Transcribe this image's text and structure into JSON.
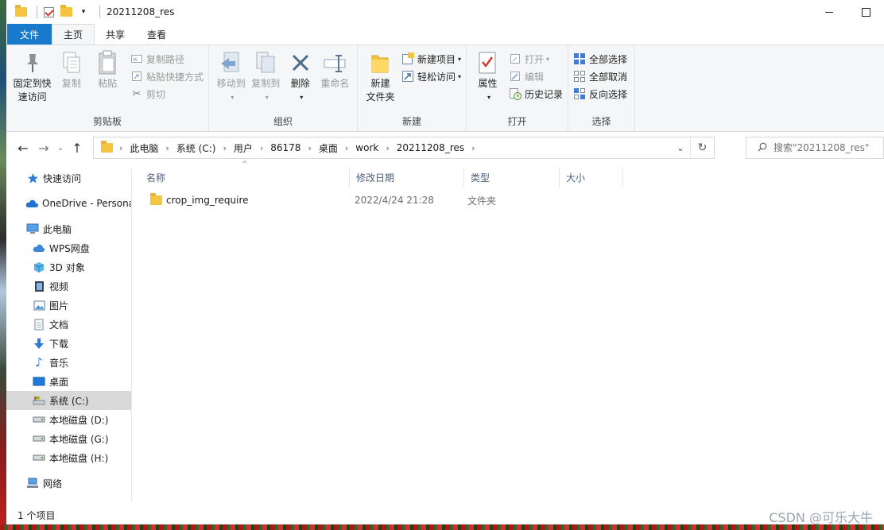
{
  "window": {
    "title": "20211208_res"
  },
  "tabs": [
    "文件",
    "主页",
    "共享",
    "查看"
  ],
  "ribbon": {
    "clipboard": {
      "label": "剪贴板",
      "pin": "固定到快\n速访问",
      "copy": "复制",
      "paste": "粘贴",
      "copy_path": "复制路径",
      "paste_shortcut": "粘贴快捷方式",
      "cut": "剪切"
    },
    "organize": {
      "label": "组织",
      "move_to": "移动到",
      "copy_to": "复制到",
      "delete": "删除",
      "rename": "重命名"
    },
    "new": {
      "label": "新建",
      "new_folder": "新建\n文件夹",
      "new_item": "新建项目",
      "easy_access": "轻松访问"
    },
    "open": {
      "label": "打开",
      "properties": "属性",
      "open": "打开",
      "edit": "编辑",
      "history": "历史记录"
    },
    "select": {
      "label": "选择",
      "select_all": "全部选择",
      "select_none": "全部取消",
      "invert": "反向选择"
    }
  },
  "address": {
    "crumbs": [
      "此电脑",
      "系统 (C:)",
      "用户",
      "86178",
      "桌面",
      "work",
      "20211208_res"
    ]
  },
  "search": {
    "placeholder": "搜索\"20211208_res\""
  },
  "nav": [
    {
      "label": "快速访问",
      "icon": "star-icon"
    },
    {
      "label": "OneDrive - Personal",
      "icon": "cloud-icon"
    },
    {
      "label": "此电脑",
      "icon": "computer-icon"
    },
    {
      "label": "WPS网盘",
      "icon": "wps-cloud-icon"
    },
    {
      "label": "3D 对象",
      "icon": "cube-icon"
    },
    {
      "label": "视频",
      "icon": "video-icon"
    },
    {
      "label": "图片",
      "icon": "picture-icon"
    },
    {
      "label": "文档",
      "icon": "document-icon"
    },
    {
      "label": "下载",
      "icon": "download-icon"
    },
    {
      "label": "音乐",
      "icon": "music-icon"
    },
    {
      "label": "桌面",
      "icon": "desktop-icon"
    },
    {
      "label": "系统 (C:)",
      "icon": "drive-c-icon"
    },
    {
      "label": "本地磁盘 (D:)",
      "icon": "drive-icon"
    },
    {
      "label": "本地磁盘 (G:)",
      "icon": "drive-icon"
    },
    {
      "label": "本地磁盘 (H:)",
      "icon": "drive-icon"
    },
    {
      "label": "网络",
      "icon": "network-icon"
    }
  ],
  "columns": [
    "名称",
    "修改日期",
    "类型",
    "大小"
  ],
  "files": [
    {
      "name": "crop_img_require",
      "date": "2022/4/24 21:28",
      "type": "文件夹",
      "size": ""
    }
  ],
  "status": {
    "count": "1 个项目"
  },
  "watermark": "CSDN @可乐大牛",
  "colors": {
    "file_tab": "#1979ca",
    "selected_nav": "#d9d9d9",
    "folder": "#f5c542"
  }
}
